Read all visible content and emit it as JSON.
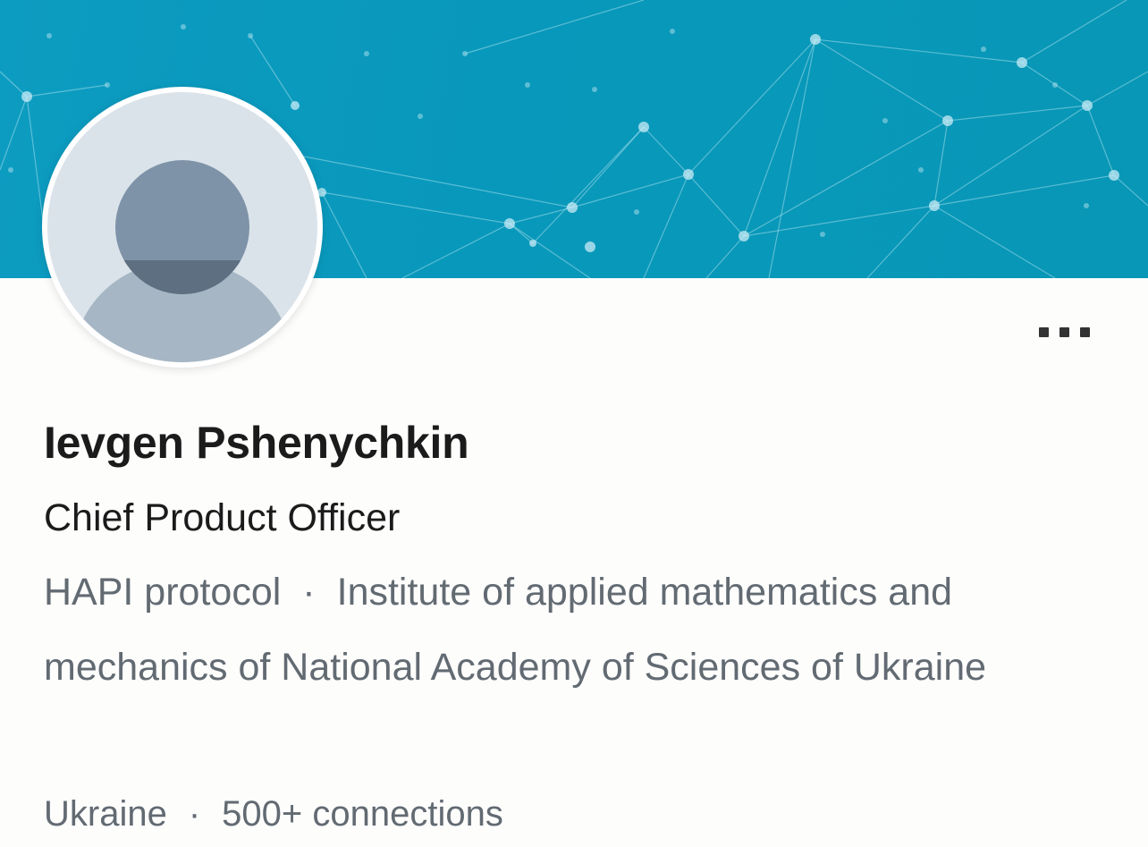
{
  "profile": {
    "name": "Ievgen Pshenychkin",
    "headline": "Chief Product Officer",
    "company": "HAPI protocol",
    "education": "Institute of applied mathematics and mechanics of National Academy of Sciences of Ukraine",
    "location": "Ukraine",
    "connections": "500+ connections",
    "separator": "·"
  },
  "icons": {
    "avatar": "default-person-avatar-icon",
    "more": "more-options-icon"
  },
  "colors": {
    "banner": "#0898bb",
    "name": "#1b1b1b",
    "secondary_text": "#626a72"
  }
}
